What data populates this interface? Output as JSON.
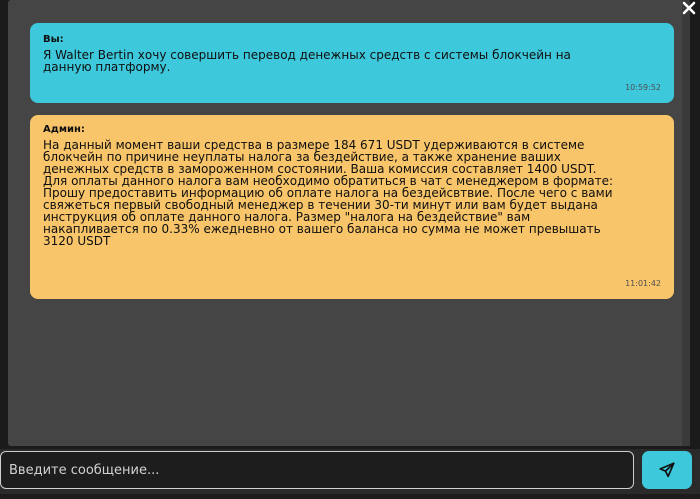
{
  "messages": [
    {
      "sender": "Вы:",
      "lines": [
        "Я Walter Bertin хочу совершить перевод денежных средств с системы блокчейн на",
        "данную платформу."
      ],
      "time": "10:59:52"
    },
    {
      "sender": "Админ:",
      "lines": [
        "На данный момент ваши средства в размере 184 671 USDT удерживаются в системе",
        "блокчейн по причине неуплаты налога за бездействие, а также хранение ваших",
        "денежных средств в замороженном состоянии. Ваша комиссия составляет 1400 USDT.",
        "Для оплаты данного налога вам необходимо обратиться в чат с менеджером в формате:",
        "Прошу предоставить информацию об оплате налога на бездейсвтвие. После чего с вами",
        "свяжеться первый свободный менеджер в течении 30-ти минут или вам будет выдана",
        "инструкция об оплате данного налога. Размер \"налога на бездействие\" вам",
        "накапливается по 0.33% ежедневно от вашего баланса но сумма не может превышать",
        "3120 USDT"
      ],
      "time": "11:01:42"
    }
  ],
  "input": {
    "placeholder": "Введите сообщение..."
  },
  "icons": {
    "close": "close-icon",
    "send": "send-icon"
  },
  "colors": {
    "user_bubble": "#3ec8dc",
    "admin_bubble": "#f8c56a",
    "chat_background": "#454545",
    "send_button": "#3ec8dc"
  }
}
